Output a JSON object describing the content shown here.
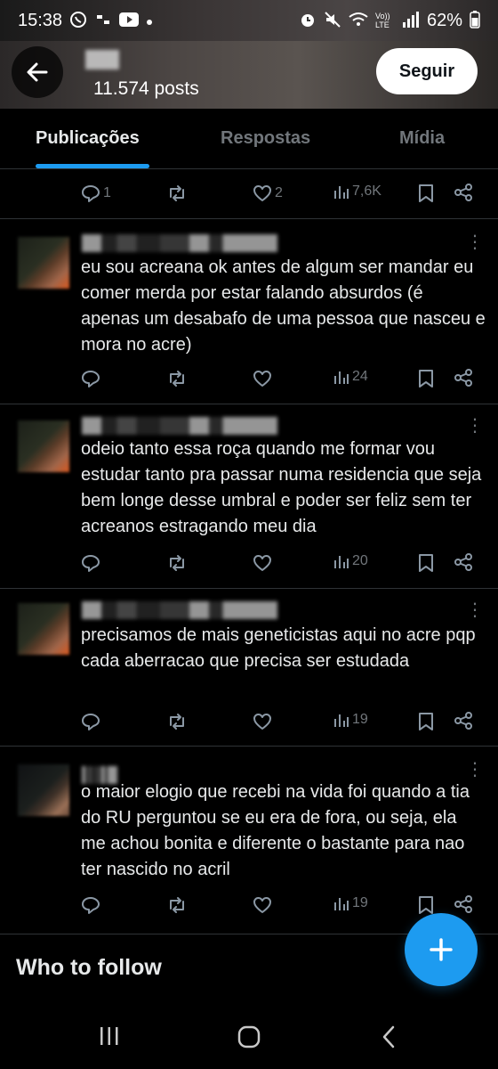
{
  "status_bar": {
    "time": "15:38",
    "left_icons": [
      "whatsapp-icon",
      "notification-icon",
      "youtube-icon",
      "dot-icon"
    ],
    "right_icons": [
      "alarm-icon",
      "mute-icon",
      "wifi-icon",
      "volte-icon",
      "signal-icon"
    ],
    "volte_label": "Vo)) LTE",
    "battery": "62%"
  },
  "header": {
    "post_count": "11.574 posts",
    "follow_label": "Seguir"
  },
  "tabs": [
    {
      "label": "Publicações",
      "active": true
    },
    {
      "label": "Respostas",
      "active": false
    },
    {
      "label": "Mídia",
      "active": false
    }
  ],
  "first_actions": {
    "replies": "1",
    "reposts": "",
    "likes": "2",
    "views": "7,6K"
  },
  "tweets": [
    {
      "text": "eu sou acreana ok antes de algum ser mandar eu comer merda por estar falando absurdos (é apenas um desabafo de uma pessoa que nasceu e mora no acre)",
      "replies": "",
      "reposts": "",
      "likes": "",
      "views": "24"
    },
    {
      "text": "odeio tanto essa roça quando me formar vou estudar tanto pra passar numa residencia que seja bem longe desse umbral e poder ser feliz sem ter acreanos estragando meu dia",
      "replies": "",
      "reposts": "",
      "likes": "",
      "views": "20"
    },
    {
      "text": "precisamos de mais geneticistas aqui no acre pqp cada aberracao que precisa ser estudada",
      "replies": "",
      "reposts": "",
      "likes": "",
      "views": "19"
    },
    {
      "text": "o maior elogio que recebi na vida foi quando a tia do RU perguntou se eu era de fora, ou seja, ela me achou bonita e diferente o bastante para nao ter nascido no acril",
      "replies": "",
      "reposts": "",
      "likes": "",
      "views": "19"
    }
  ],
  "who_to_follow": "Who to follow",
  "colors": {
    "background": "#000000",
    "text": "#e7e9ea",
    "muted": "#71767b",
    "accent": "#1d9bf0",
    "divider": "#2f3336"
  }
}
